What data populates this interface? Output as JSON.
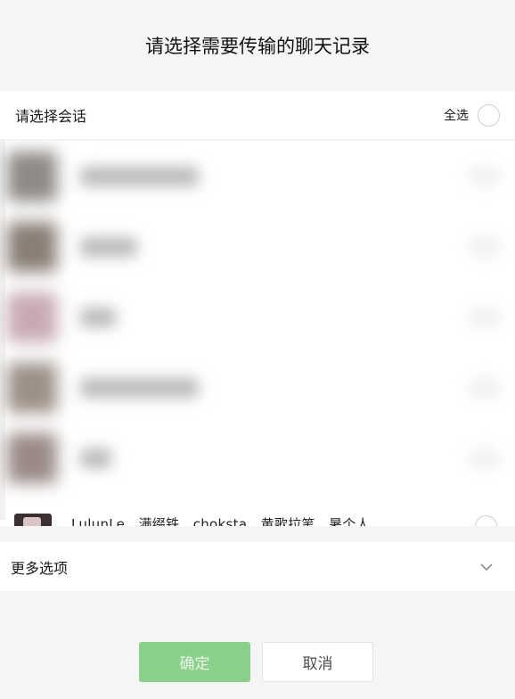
{
  "dialog": {
    "title": "请选择需要传输的聊天记录"
  },
  "select_header": {
    "label": "请选择会话",
    "select_all_label": "全选"
  },
  "conversations": [
    {
      "avatar_color": "#8e8a86",
      "name_width_fraction": 0.23
    },
    {
      "avatar_color": "#8a7f76",
      "name_width_fraction": 0.11
    },
    {
      "avatar_color": "#c8aab4",
      "name_width_fraction": 0.07
    },
    {
      "avatar_color": "#9d9087",
      "name_width_fraction": 0.23
    },
    {
      "avatar_color": "#9a8a87",
      "name_width_fraction": 0.06
    }
  ],
  "partial_conversation": {
    "name": "LulunLe、满缀铁、choksta、黄歌拉笔、暑个人"
  },
  "more_options": {
    "label": "更多选项"
  },
  "buttons": {
    "confirm": "确定",
    "cancel": "取消"
  },
  "colors": {
    "confirm_bg": "#8ad08a",
    "page_bg": "#f5f5f5"
  }
}
